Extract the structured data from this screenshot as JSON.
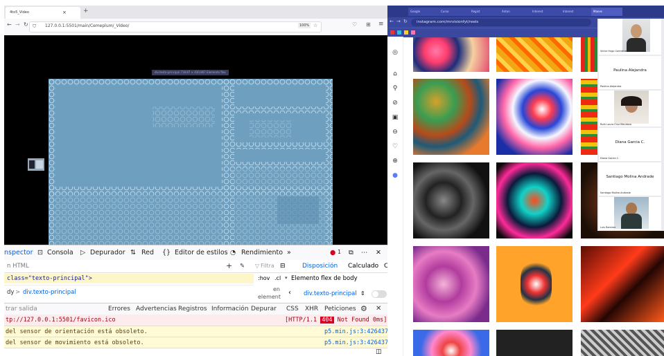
{
  "firefox": {
    "tab_title": "4to5_Video",
    "url": "127.0.0.1:5501/main/Cemeplum/_Video/",
    "zoom": "100%",
    "sketch_tooltip": "div.texto-principal  718.87 × 430.867  Elemento flex",
    "devtools": {
      "tabs": [
        "nspector",
        "Consola",
        "Depurador",
        "Red",
        "Editor de estilos",
        "Rendimiento"
      ],
      "error_count": "1",
      "inspector_search_placeholder": "n HTML",
      "html_line": "class=\"texto-principal\">",
      "breadcrumb_prefix": "dy",
      "breadcrumb_sep": ">",
      "breadcrumb_item": "div.texto-principal",
      "layout_panel": {
        "filter_placeholder": "Filtra",
        "tab_layout": "Disposición",
        "tab_computed": "Calculado",
        "tab_cut": "C",
        "hov": ":hov",
        "cls": ".cl",
        "flex_header": "Elemento flex de body",
        "en_element_1": "en",
        "en_element_2": "element",
        "flex_item": "div.texto-principal"
      },
      "console_toolbar": {
        "filter_placeholder": "trar salida",
        "filters": [
          "Errores",
          "Advertencias",
          "Registros",
          "Información",
          "Depurar"
        ],
        "right": [
          "CSS",
          "XHR",
          "Peticiones"
        ]
      },
      "console_rows": [
        {
          "msg": "tp://127.0.0.1:5501/favicon.ico",
          "right": "[HTTP/1.1 404 Not Found 0ms]",
          "status": "404",
          "kind": "error"
        },
        {
          "msg": "del sensor de orientación está obsoleto.",
          "right": "p5.min.js:3:426437",
          "kind": "warn"
        },
        {
          "msg": "del sensor de movimiento está obsoleto.",
          "right": "p5.min.js:3:426437",
          "kind": "warn"
        }
      ]
    }
  },
  "chrome": {
    "tabs": [
      "Google",
      "Curso",
      "Regist",
      "Anton",
      "Interest",
      "Interest",
      "Manes"
    ],
    "url": "instagram.com/mrvisionfyt/reels",
    "colors": {
      "tabbar": "#2d3a8a",
      "addr": "#3a48a0"
    }
  },
  "meeting": {
    "participants": [
      {
        "name": "Victor Hugo Contreras"
      },
      {
        "name": "Paulina Alejandra",
        "sub": "Paulina Alejandra"
      },
      {
        "name": "Ruth Laura Cruz Mendoza"
      },
      {
        "name": "Diana Garcia C.",
        "sub": "Diana Garcia C."
      },
      {
        "name": "Santiago Molina Andrade",
        "sub": "Santiago Molina Andrade"
      },
      {
        "name": "Luis Ramirez"
      }
    ]
  }
}
